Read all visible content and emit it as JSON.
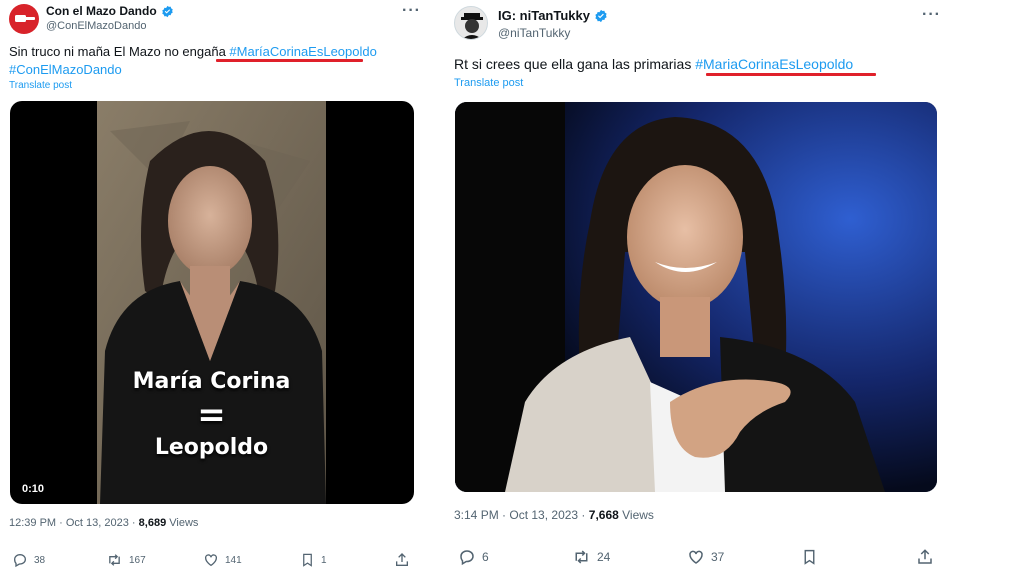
{
  "left_tweet": {
    "display_name": "Con el Mazo Dando",
    "handle": "@ConElMazoDando",
    "more_icon": "more-dots-icon",
    "text_prefix": "Sin truco ni maña El Mazo no engaña ",
    "hashtag_1": "#MaríaCorinaEsLeopoldo",
    "hashtag_2": "#ConElMazoDando",
    "translate": "Translate post",
    "media": {
      "overlay_line1": "María Corina",
      "overlay_equals": "=",
      "overlay_line2": "Leopoldo",
      "duration": "0:10"
    },
    "time": "12:39 PM",
    "date": "Oct 13, 2023",
    "views_count": "8,689",
    "views_label": "Views",
    "actions": {
      "replies": "38",
      "reposts": "167",
      "likes": "141",
      "bookmarks": "1"
    }
  },
  "right_tweet": {
    "display_name": "IG: niTanTukky",
    "handle": "@niTanTukky",
    "more_icon": "more-dots-icon",
    "text_prefix": "Rt si crees que ella gana las primarias ",
    "hashtag_1": "#MariaCorinaEsLeopoldo",
    "translate": "Translate post",
    "time": "3:14 PM",
    "date": "Oct 13, 2023",
    "views_count": "7,668",
    "views_label": "Views",
    "actions": {
      "replies": "6",
      "reposts": "24",
      "likes": "37"
    }
  },
  "colors": {
    "link": "#1d9bf0",
    "verified": "#1d9bf0",
    "annotation_underline": "#e0202a",
    "secondary_text": "#536471"
  }
}
